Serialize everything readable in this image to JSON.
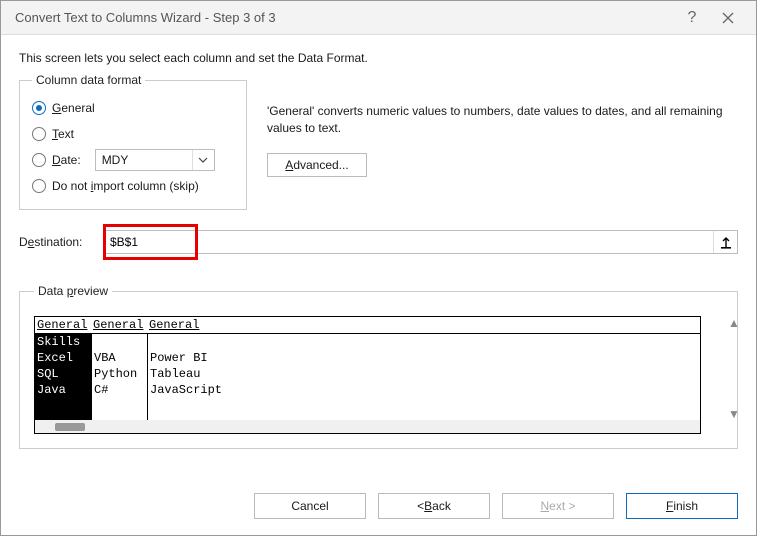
{
  "titlebar": {
    "title": "Convert Text to Columns Wizard - Step 3 of 3"
  },
  "intro": "This screen lets you select each column and set the Data Format.",
  "column_format": {
    "legend": "Column data format",
    "options": {
      "general": {
        "label": "General",
        "accel": "G",
        "checked": true
      },
      "text": {
        "label": "Text",
        "accel": "T",
        "checked": false
      },
      "date": {
        "label": "Date:",
        "accel": "D",
        "checked": false,
        "select_value": "MDY"
      },
      "skip": {
        "label": "Do not import column (skip)",
        "accel": "I",
        "checked": false
      }
    }
  },
  "desc": "'General' converts numeric values to numbers, date values to dates, and all remaining values to text.",
  "advanced_label": "Advanced...",
  "advanced_accel": "A",
  "destination": {
    "label": "Destination:",
    "accel": "E",
    "value": "$B$1",
    "highlighted": true
  },
  "preview": {
    "legend": "Data preview",
    "legend_accel": "P",
    "headers": [
      "General",
      "General",
      "General"
    ],
    "columns": [
      [
        "Skills",
        "Excel",
        "SQL",
        "Java"
      ],
      [
        "",
        "VBA",
        "Python",
        "C#"
      ],
      [
        "",
        "Power BI",
        "Tableau",
        "JavaScript"
      ]
    ]
  },
  "buttons": {
    "cancel": "Cancel",
    "back": "< Back",
    "back_accel": "B",
    "next": "Next >",
    "next_accel": "N",
    "finish": "Finish",
    "finish_accel": "F"
  }
}
